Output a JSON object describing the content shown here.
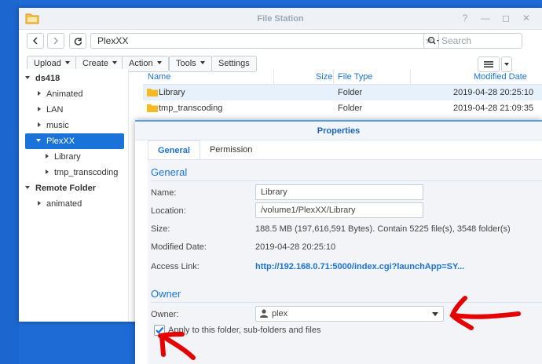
{
  "app": {
    "title": "File Station"
  },
  "navigation": {
    "path": "PlexXX",
    "search_placeholder": "Search"
  },
  "toolbar": {
    "upload_label": "Upload",
    "create_label": "Create",
    "action_label": "Action",
    "tools_label": "Tools",
    "settings_label": "Settings"
  },
  "sidebar": {
    "items": [
      {
        "label": "ds418"
      },
      {
        "label": "Animated"
      },
      {
        "label": "LAN"
      },
      {
        "label": "music"
      },
      {
        "label": "PlexXX"
      },
      {
        "label": "Library"
      },
      {
        "label": "tmp_transcoding"
      },
      {
        "label": "Remote Folder"
      },
      {
        "label": "animated"
      }
    ]
  },
  "filelist": {
    "columns": {
      "name": "Name",
      "size": "Size",
      "type": "File Type",
      "modified": "Modified Date"
    },
    "rows": [
      {
        "name": "Library",
        "size": "",
        "type": "Folder",
        "modified": "2019-04-28 20:25:10"
      },
      {
        "name": "tmp_transcoding",
        "size": "",
        "type": "Folder",
        "modified": "2019-04-28 21:09:35"
      }
    ]
  },
  "properties": {
    "title": "Properties",
    "tabs": [
      {
        "label": "General"
      },
      {
        "label": "Permission"
      }
    ],
    "general_section": "General",
    "name_label": "Name:",
    "name_value": "Library",
    "location_label": "Location:",
    "location_value": "/volume1/PlexXX/Library",
    "size_label": "Size:",
    "size_value": "188.5 MB (197,616,591 Bytes). Contain 5225 file(s), 3548 folder(s)",
    "modified_label": "Modified Date:",
    "modified_value": "2019-04-28 20:25:10",
    "access_label": "Access Link:",
    "access_value": "http://192.168.0.71:5000/index.cgi?launchApp=SY...",
    "owner_section": "Owner",
    "owner_label": "Owner:",
    "owner_value": "plex",
    "apply_label": "Apply to this folder, sub-folders and files",
    "apply_checked": true
  },
  "colors": {
    "accent": "#1a73d9",
    "desktop": "#1e6bd6",
    "annotation": "#e60000"
  }
}
